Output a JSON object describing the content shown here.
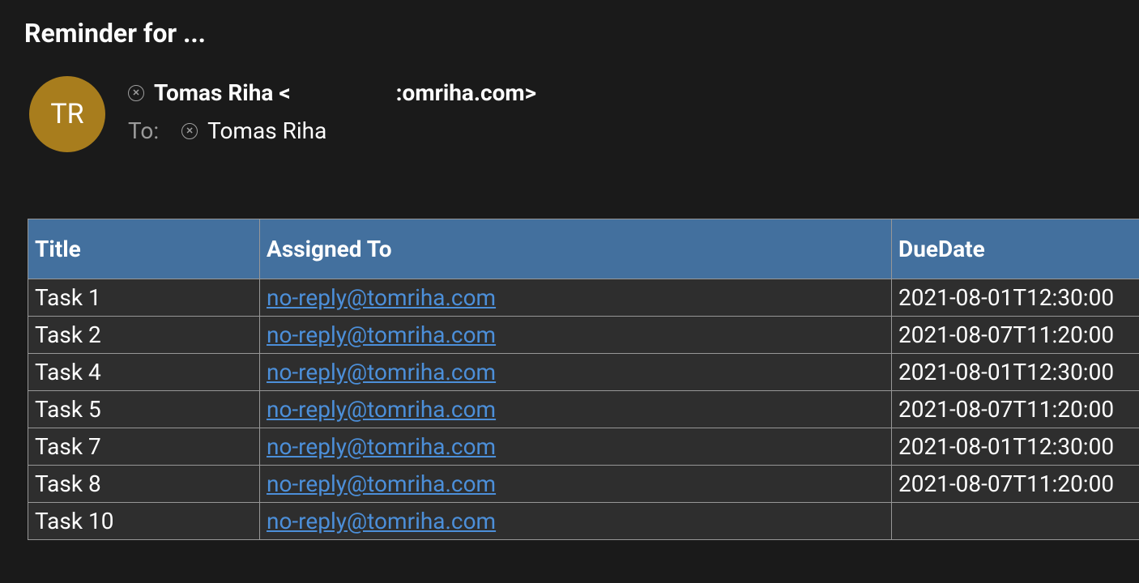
{
  "subject": "Reminder for ...",
  "avatar_initials": "TR",
  "from_display": "Tomas Riha <",
  "from_domain_fragment": ":omriha.com>",
  "to_label": "To:",
  "to_display": "Tomas Riha",
  "columns": {
    "title": "Title",
    "assigned": "Assigned To",
    "due": "DueDate"
  },
  "rows": [
    {
      "title": "Task 1",
      "assigned": "no-reply@tomriha.com",
      "due": "2021-08-01T12:30:00"
    },
    {
      "title": "Task 2",
      "assigned": "no-reply@tomriha.com",
      "due": "2021-08-07T11:20:00"
    },
    {
      "title": "Task 4",
      "assigned": "no-reply@tomriha.com",
      "due": "2021-08-01T12:30:00"
    },
    {
      "title": "Task 5",
      "assigned": "no-reply@tomriha.com",
      "due": "2021-08-07T11:20:00"
    },
    {
      "title": "Task 7",
      "assigned": "no-reply@tomriha.com",
      "due": "2021-08-01T12:30:00"
    },
    {
      "title": "Task 8",
      "assigned": "no-reply@tomriha.com",
      "due": "2021-08-07T11:20:00"
    },
    {
      "title": "Task 10",
      "assigned": "no-reply@tomriha.com",
      "due": ""
    }
  ]
}
